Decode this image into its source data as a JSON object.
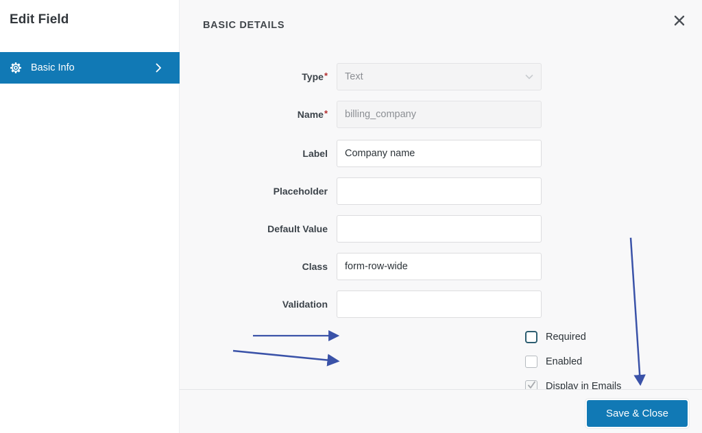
{
  "sidebar": {
    "title": "Edit Field",
    "items": [
      {
        "label": "Basic Info",
        "icon": "gear-icon",
        "chevron": "chevron-right-icon",
        "active": true
      }
    ]
  },
  "panel": {
    "heading": "BASIC DETAILS",
    "close_icon": "close-icon"
  },
  "form": {
    "rows": [
      {
        "label": "Type",
        "required": true,
        "control": "select",
        "value": "Text",
        "disabled": true,
        "placeholder": ""
      },
      {
        "label": "Name",
        "required": true,
        "control": "input",
        "value": "billing_company",
        "disabled": true,
        "placeholder": ""
      },
      {
        "label": "Label",
        "required": false,
        "control": "input",
        "value": "Company name",
        "disabled": false,
        "placeholder": ""
      },
      {
        "label": "Placeholder",
        "required": false,
        "control": "input",
        "value": "",
        "disabled": false,
        "placeholder": ""
      },
      {
        "label": "Default Value",
        "required": false,
        "control": "input",
        "value": "",
        "disabled": false,
        "placeholder": ""
      },
      {
        "label": "Class",
        "required": false,
        "control": "input",
        "value": "form-row-wide",
        "disabled": false,
        "placeholder": ""
      },
      {
        "label": "Validation",
        "required": false,
        "control": "input",
        "value": "",
        "disabled": false,
        "placeholder": ""
      }
    ],
    "checkboxes": [
      {
        "label": "Required",
        "checked": false,
        "focused": true
      },
      {
        "label": "Enabled",
        "checked": false,
        "focused": false
      },
      {
        "label": "Display in Emails",
        "checked": true,
        "focused": false
      }
    ]
  },
  "footer": {
    "save_label": "Save & Close"
  },
  "colors": {
    "accent_blue": "#1179b5",
    "required_red": "#b32d2e",
    "annotation_blue": "#3a52a8",
    "panel_background": "#f8f8f9"
  }
}
